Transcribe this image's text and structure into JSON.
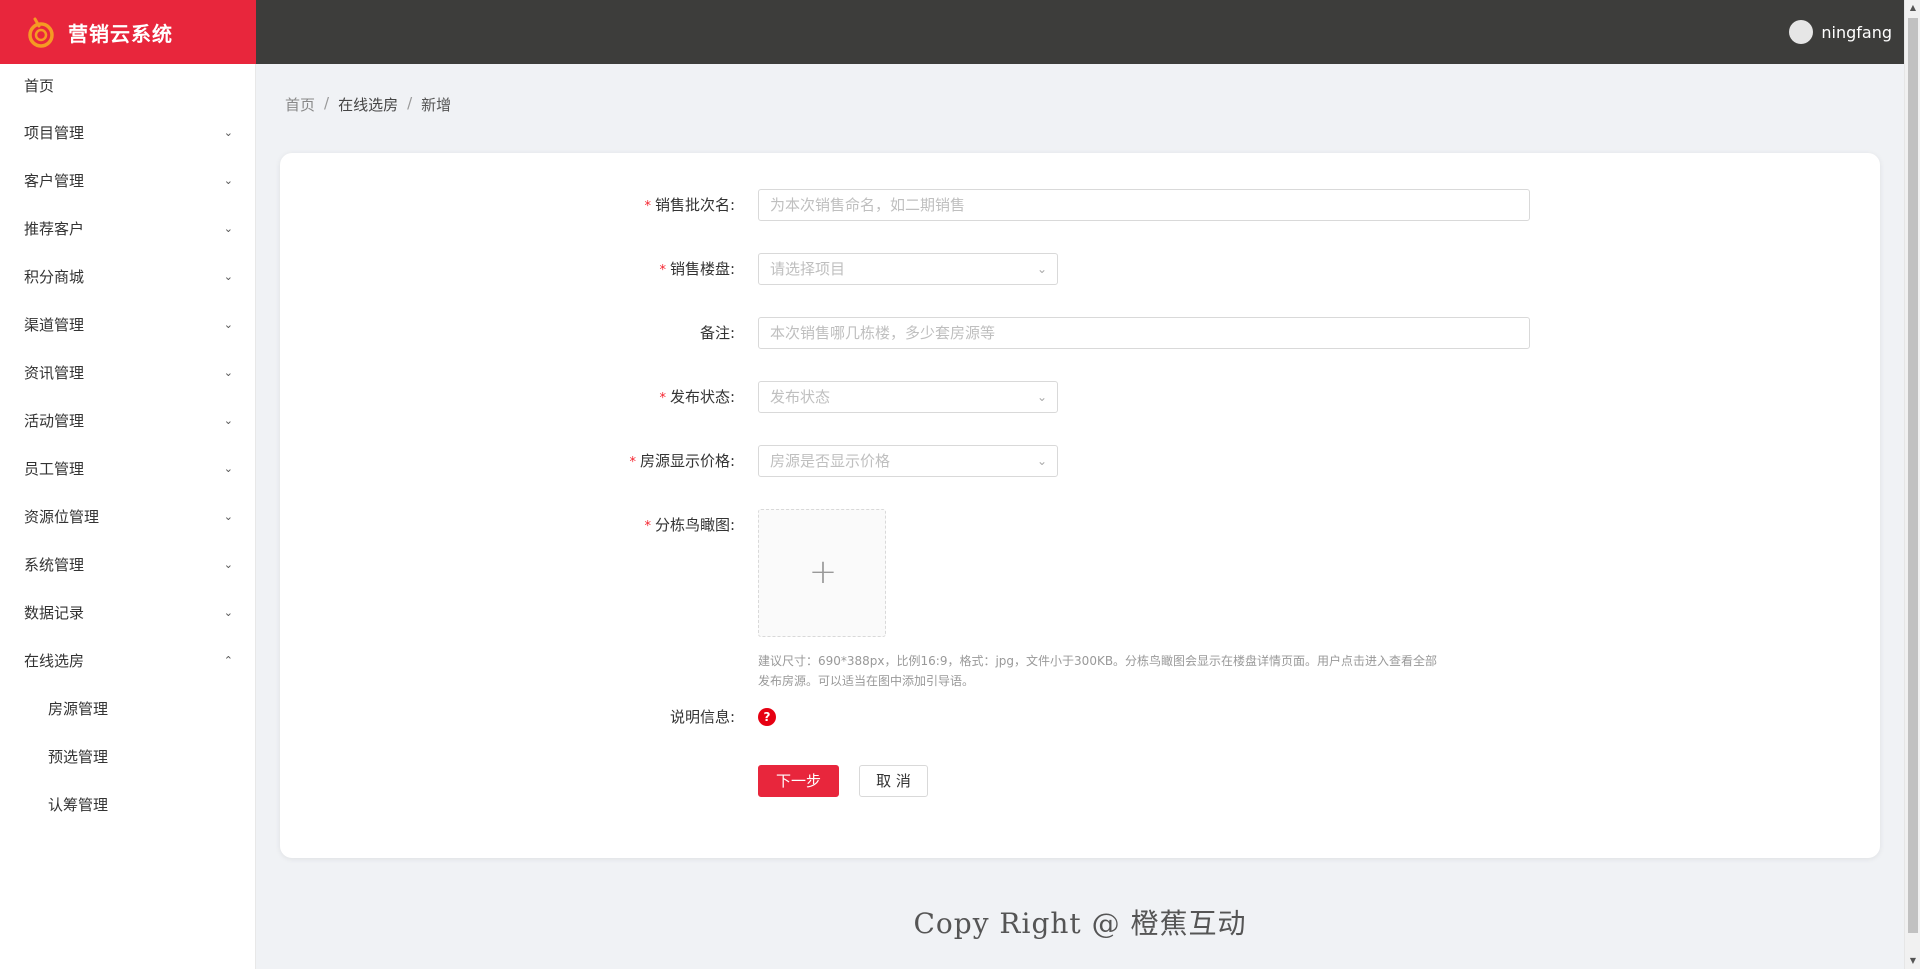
{
  "app": {
    "title": "营销云系统",
    "brand_color": "#e8263c",
    "header_color": "#3d3d3b"
  },
  "user": {
    "name": "ningfang"
  },
  "sidebar": {
    "items": [
      {
        "label": "首页",
        "icon": ""
      },
      {
        "label": "项目管理",
        "icon": "chevron-down-icon"
      },
      {
        "label": "客户管理",
        "icon": "chevron-down-icon"
      },
      {
        "label": "推荐客户",
        "icon": "chevron-down-icon"
      },
      {
        "label": "积分商城",
        "icon": "chevron-down-icon"
      },
      {
        "label": "渠道管理",
        "icon": "chevron-down-icon"
      },
      {
        "label": "资讯管理",
        "icon": "chevron-down-icon"
      },
      {
        "label": "活动管理",
        "icon": "chevron-down-icon"
      },
      {
        "label": "员工管理",
        "icon": "chevron-down-icon"
      },
      {
        "label": "资源位管理",
        "icon": "chevron-down-icon"
      },
      {
        "label": "系统管理",
        "icon": "chevron-down-icon"
      },
      {
        "label": "数据记录",
        "icon": "chevron-down-icon"
      },
      {
        "label": "在线选房",
        "icon": "chevron-up-icon"
      }
    ],
    "submenu": [
      {
        "label": "房源管理"
      },
      {
        "label": "预选管理"
      },
      {
        "label": "认筹管理"
      }
    ]
  },
  "breadcrumb": [
    "首页",
    "在线选房",
    "新增"
  ],
  "form": {
    "batch_name": {
      "label": "销售批次名:",
      "placeholder": "为本次销售命名，如二期销售",
      "required": true
    },
    "project": {
      "label": "销售楼盘:",
      "placeholder": "请选择项目",
      "required": true
    },
    "remark": {
      "label": "备注:",
      "placeholder": "本次销售哪几栋楼，多少套房源等",
      "required": false
    },
    "publish_status": {
      "label": "发布状态:",
      "placeholder": "发布状态",
      "required": true
    },
    "show_price": {
      "label": "房源显示价格:",
      "placeholder": "房源是否显示价格",
      "required": true
    },
    "aerial_image": {
      "label": "分栋鸟瞰图:",
      "required": true,
      "plus": "+"
    },
    "hint_line1": "建议尺寸：690*388px，比例16:9，格式：jpg，文件小于300KB。分栋鸟瞰图会显示在楼盘详情页面。用户点击进入查看全部",
    "hint_line2": "发布房源。可以适当在图中添加引导语。",
    "description": {
      "label": "说明信息:",
      "help": "?"
    },
    "required_mark": "*",
    "next_button": "下一步",
    "cancel_button": "取 消"
  },
  "footer": {
    "text": "Copy Right @ 橙蕉互动"
  }
}
